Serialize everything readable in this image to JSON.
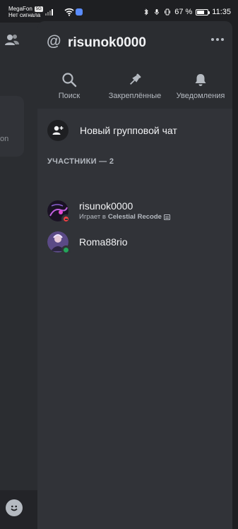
{
  "status_bar": {
    "carrier": "MegaFon",
    "network_badge": "5G",
    "signal_note": "Нет сигнала",
    "battery": "67 %",
    "battery_level": 0.67,
    "time": "11:35"
  },
  "background": {
    "card_text": "on"
  },
  "dm": {
    "at_symbol": "@",
    "title": "risunok0000",
    "more_icon": "more-horizontal-icon"
  },
  "actions": [
    {
      "label": "Поиск",
      "icon": "search-icon"
    },
    {
      "label": "Закреплённые",
      "icon": "pin-icon"
    },
    {
      "label": "Уведомления",
      "icon": "bell-icon"
    }
  ],
  "new_group": {
    "label": "Новый групповой чат",
    "icon": "add-user-icon"
  },
  "members_header": "УЧАСТНИКИ — 2",
  "members": [
    {
      "name": "risunok0000",
      "activity_prefix": "Играет в",
      "activity_game": "Celestial Recode",
      "status": "dnd",
      "status_color": "#f23f43",
      "avatar_color": "#3a1f4a"
    },
    {
      "name": "Roma88rio",
      "status": "online",
      "status_color": "#23a55a",
      "avatar_color": "#6b4f8a"
    }
  ],
  "colors": {
    "drawer_bg": "#2b2d31",
    "list_bg": "#313338",
    "text_primary": "#f2f3f5",
    "text_muted": "#b5bac1"
  }
}
